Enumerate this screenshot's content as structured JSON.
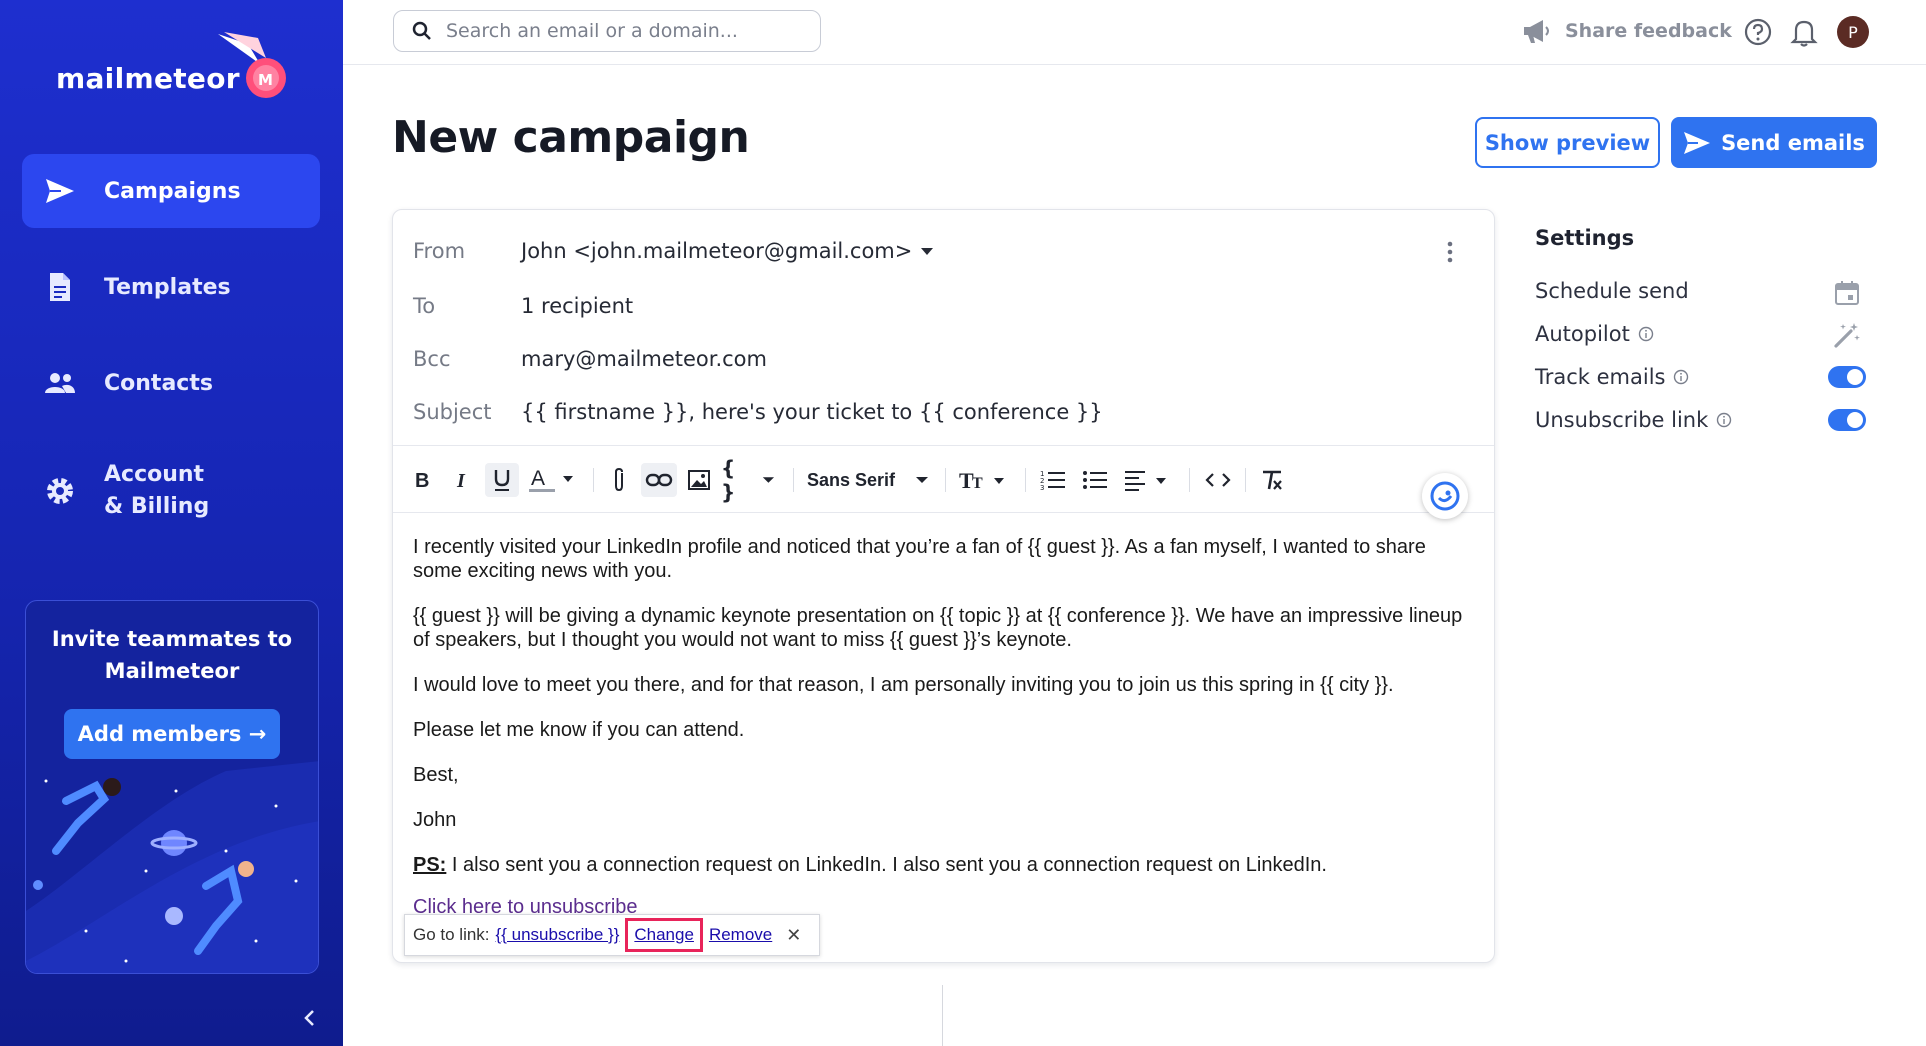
{
  "app": {
    "name": "mailmeteor"
  },
  "sidebar": {
    "items": [
      {
        "label": "Campaigns",
        "icon": "send-icon",
        "active": true
      },
      {
        "label": "Templates",
        "icon": "document-icon",
        "active": false
      },
      {
        "label": "Contacts",
        "icon": "people-icon",
        "active": false
      },
      {
        "label_line1": "Account",
        "label_line2": "& Billing",
        "icon": "gear-icon",
        "active": false
      }
    ],
    "invite": {
      "title_line1": "Invite teammates to",
      "title_line2": "Mailmeteor",
      "button_label": "Add members →"
    }
  },
  "topbar": {
    "search_placeholder": "Search an email or a domain...",
    "feedback_label": "Share feedback",
    "avatar_initial": "P"
  },
  "header": {
    "title": "New campaign",
    "preview_label": "Show preview",
    "send_label": "Send emails"
  },
  "composer": {
    "fields": [
      {
        "label": "From",
        "value": "John <john.mailmeteor@gmail.com>"
      },
      {
        "label": "To",
        "value": "1 recipient"
      },
      {
        "label": "Bcc",
        "value": "mary@mailmeteor.com"
      },
      {
        "label": "Subject",
        "value": "{{ firstname }}, here's your ticket to {{ conference }}"
      }
    ],
    "toolbar": {
      "font": "Sans Serif",
      "variables": "{ }"
    },
    "body": [
      "I recently visited your LinkedIn profile and noticed that you’re a fan of {{ guest }}. As a fan myself, I wanted to share some exciting news with you.",
      "{{ guest }} will be giving a dynamic keynote presentation on {{ topic }} at {{ conference }}. We have an impressive lineup of speakers, but I thought you would not want to miss {{ guest }}’s keynote.",
      "I would love to meet you there, and for that reason, I am personally inviting you to join us this spring in {{ city }}.",
      "Please let me know if you can attend.",
      "Best,",
      "John"
    ],
    "ps_label": "PS:",
    "ps_text": " I also sent you a connection request on LinkedIn. I also sent you a connection request on LinkedIn.",
    "unsubscribe_text": "Click here to unsubscribe",
    "link_popup": {
      "prefix": "Go to link:",
      "url": "{{ unsubscribe }}",
      "change_label": "Change",
      "remove_label": "Remove",
      "close_label": "✕"
    }
  },
  "settings": {
    "title": "Settings",
    "items": [
      {
        "label": "Schedule send",
        "control": "calendar-icon"
      },
      {
        "label": "Autopilot",
        "control": "magic-wand-icon",
        "info": true
      },
      {
        "label": "Track emails",
        "control": "toggle",
        "enabled": true,
        "info": true
      },
      {
        "label": "Unsubscribe link",
        "control": "toggle",
        "enabled": true,
        "info": true
      }
    ]
  },
  "colors": {
    "sidebar": "#1e2fcf",
    "accent": "#2f73f0",
    "highlight": "#e8245a"
  }
}
